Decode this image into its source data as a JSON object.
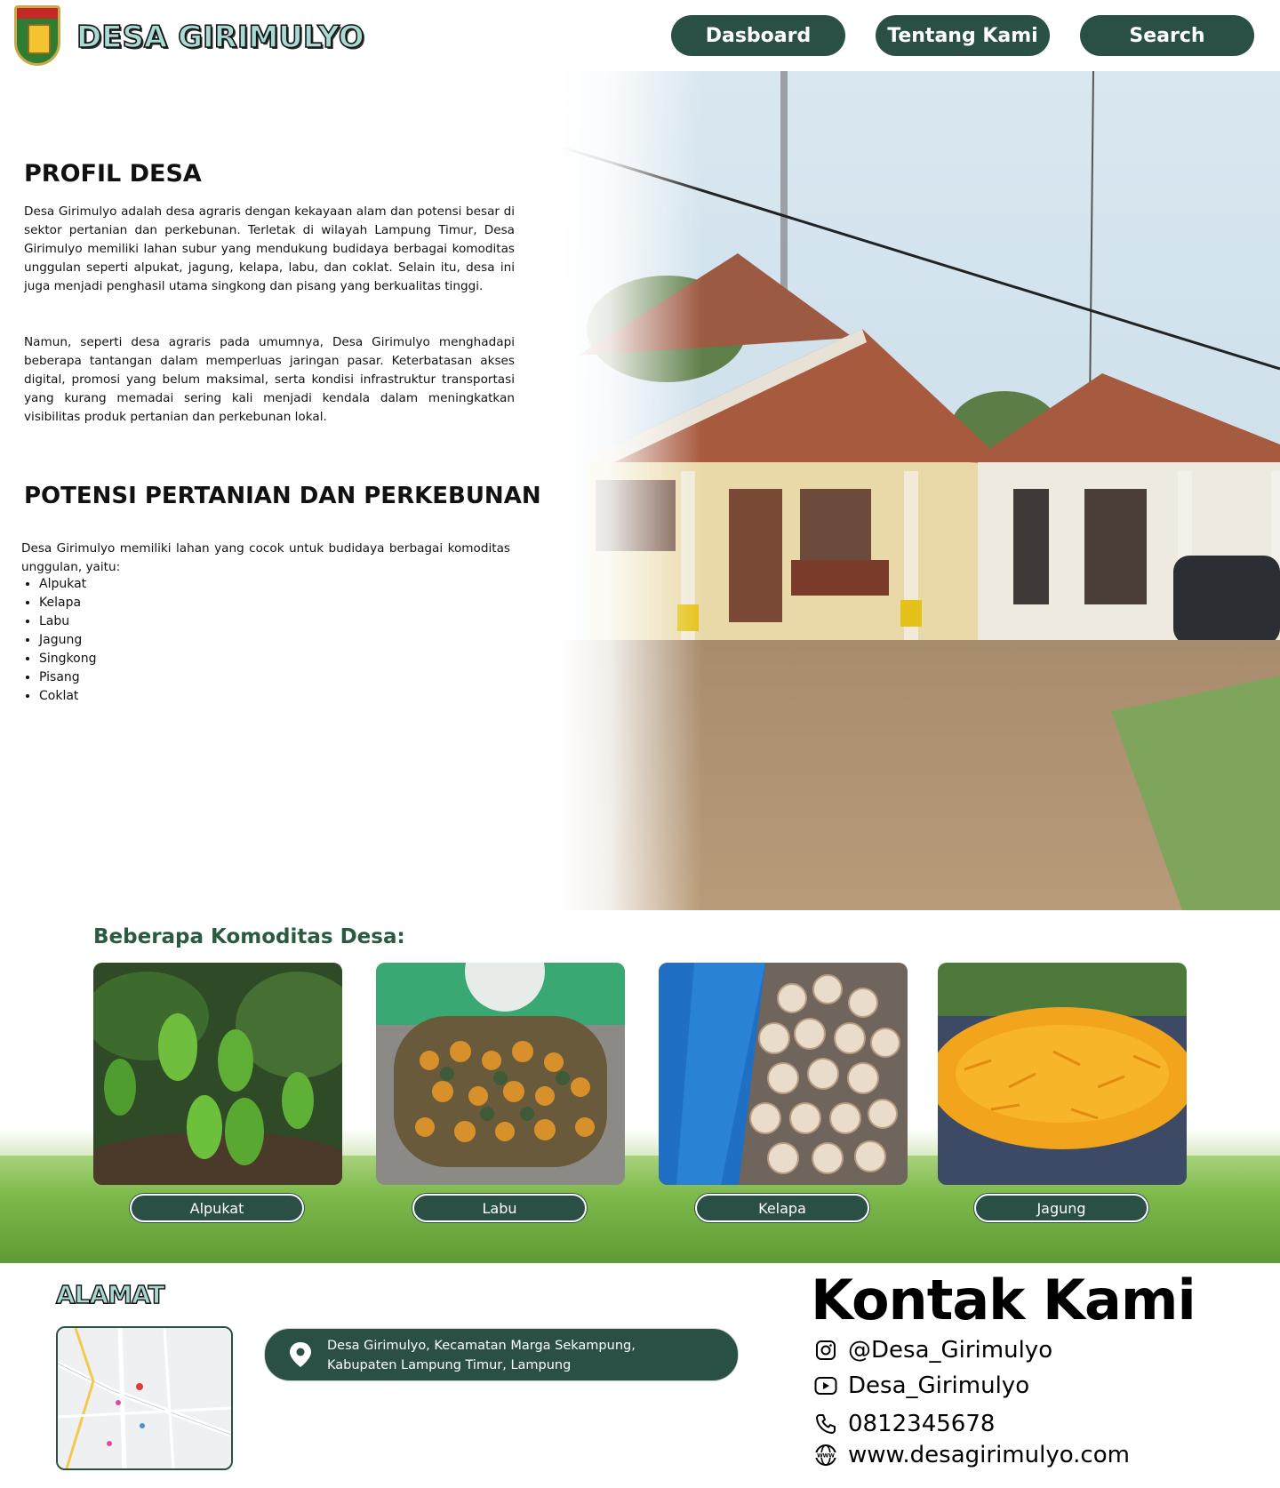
{
  "header": {
    "site_title": "DESA GIRIMULYO",
    "nav": [
      "Dasboard",
      "Tentang Kami",
      "Search"
    ]
  },
  "profil": {
    "heading": "PROFIL DESA",
    "paragraph1": "Desa Girimulyo adalah desa agraris dengan kekayaan alam dan potensi besar di sektor pertanian dan perkebunan. Terletak di wilayah Lampung Timur, Desa Girimulyo memiliki lahan subur yang mendukung budidaya berbagai komoditas unggulan seperti alpukat, jagung, kelapa, labu, dan coklat. Selain itu, desa ini juga menjadi penghasil utama singkong dan pisang yang berkualitas tinggi.",
    "paragraph2": "Namun, seperti desa agraris pada umumnya, Desa Girimulyo menghadapi beberapa tantangan dalam memperluas jaringan pasar. Keterbatasan akses digital, promosi yang belum maksimal, serta kondisi infrastruktur transportasi yang kurang memadai sering kali menjadi kendala dalam meningkatkan visibilitas produk pertanian dan perkebunan lokal."
  },
  "potensi": {
    "heading": "POTENSI PERTANIAN DAN PERKEBUNAN",
    "intro": "Desa Girimulyo memiliki lahan yang cocok untuk budidaya berbagai komoditas unggulan, yaitu:",
    "items": [
      "Alpukat",
      "Kelapa",
      "Labu",
      "Jagung",
      "Singkong",
      "Pisang",
      "Coklat"
    ]
  },
  "komoditas": {
    "title": "Beberapa Komoditas Desa:",
    "cards": [
      "Alpukat",
      "Labu",
      "Kelapa",
      "Jagung"
    ]
  },
  "alamat": {
    "title": "ALAMAT",
    "address_line1": "Desa Girimulyo, Kecamatan Marga Sekampung,",
    "address_line2": "Kabupaten Lampung Timur,  Lampung"
  },
  "kontak": {
    "title": "Kontak Kami",
    "instagram": "@Desa_Girimulyo",
    "youtube": "Desa_Girimulyo",
    "phone": "0812345678",
    "website": "www.desagirimulyo.com"
  },
  "colors": {
    "primary": "#2a4f45",
    "title_fill": "#a8d9d3",
    "komoditas_title": "#2a5a3f"
  },
  "icons": [
    "logo-emblem",
    "location-pin-icon",
    "instagram-icon",
    "youtube-icon",
    "phone-icon",
    "globe-icon"
  ]
}
